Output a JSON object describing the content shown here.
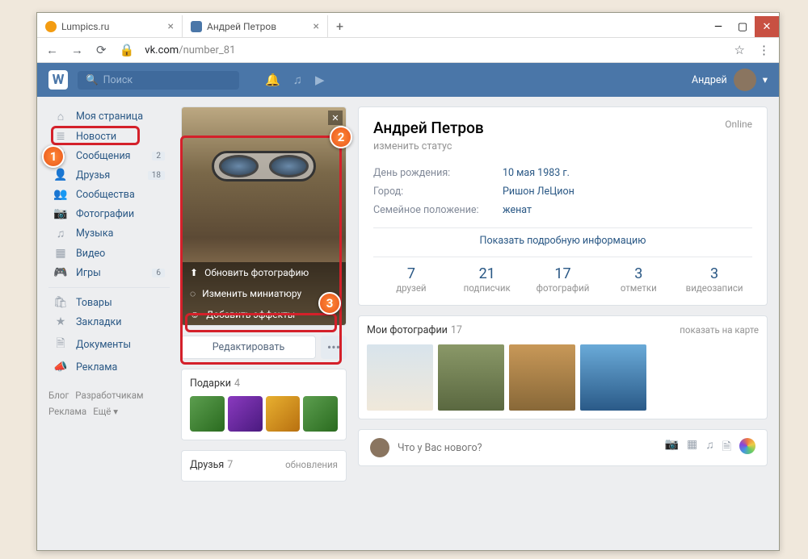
{
  "browser": {
    "tabs": [
      {
        "title": "Lumpics.ru",
        "icon_color": "#f39c12"
      },
      {
        "title": "Андрей Петров",
        "icon_color": "#4a76a8"
      }
    ],
    "url_host": "vk.com",
    "url_path": "/number_81"
  },
  "header": {
    "search_placeholder": "Поиск",
    "username": "Андрей"
  },
  "sidebar": {
    "items": [
      {
        "icon": "⌂",
        "label": "Моя страница",
        "badge": ""
      },
      {
        "icon": "≣",
        "label": "Новости",
        "badge": ""
      },
      {
        "icon": "✉",
        "label": "Сообщения",
        "badge": "2"
      },
      {
        "icon": "👤",
        "label": "Друзья",
        "badge": "18"
      },
      {
        "icon": "👥",
        "label": "Сообщества",
        "badge": ""
      },
      {
        "icon": "📷",
        "label": "Фотографии",
        "badge": ""
      },
      {
        "icon": "♫",
        "label": "Музыка",
        "badge": ""
      },
      {
        "icon": "▦",
        "label": "Видео",
        "badge": ""
      },
      {
        "icon": "🎮",
        "label": "Игры",
        "badge": "6"
      }
    ],
    "items2": [
      {
        "icon": "🛍",
        "label": "Товары"
      },
      {
        "icon": "★",
        "label": "Закладки"
      },
      {
        "icon": "🗎",
        "label": "Документы"
      },
      {
        "icon": "📣",
        "label": "Реклама"
      }
    ],
    "footer": [
      "Блог",
      "Разработчикам",
      "Реклама",
      "Ещё ▾"
    ]
  },
  "avatar_menu": {
    "update": "Обновить фотографию",
    "thumb": "Изменить миниатюру",
    "effects": "Добавить эффекты"
  },
  "buttons": {
    "edit": "Редактировать",
    "dots": "•••"
  },
  "gifts": {
    "title": "Подарки",
    "count": "4"
  },
  "friends": {
    "title": "Друзья",
    "count": "7",
    "right": "обновления"
  },
  "profile": {
    "name": "Андрей Петров",
    "online": "Online",
    "status": "изменить статус",
    "rows": [
      {
        "label": "День рождения:",
        "value": "10 мая 1983 г."
      },
      {
        "label": "Город:",
        "value": "Ришон ЛеЦион"
      },
      {
        "label": "Семейное положение:",
        "value": "женат"
      }
    ],
    "showmore": "Показать подробную информацию",
    "counters": [
      {
        "n": "7",
        "l": "друзей"
      },
      {
        "n": "21",
        "l": "подписчик"
      },
      {
        "n": "17",
        "l": "фотографий"
      },
      {
        "n": "3",
        "l": "отметки"
      },
      {
        "n": "3",
        "l": "видеозаписи"
      }
    ]
  },
  "photos": {
    "title": "Мои фотографии",
    "count": "17",
    "right": "показать на карте"
  },
  "post": {
    "placeholder": "Что у Вас нового?"
  },
  "markers": {
    "1": "1",
    "2": "2",
    "3": "3"
  }
}
